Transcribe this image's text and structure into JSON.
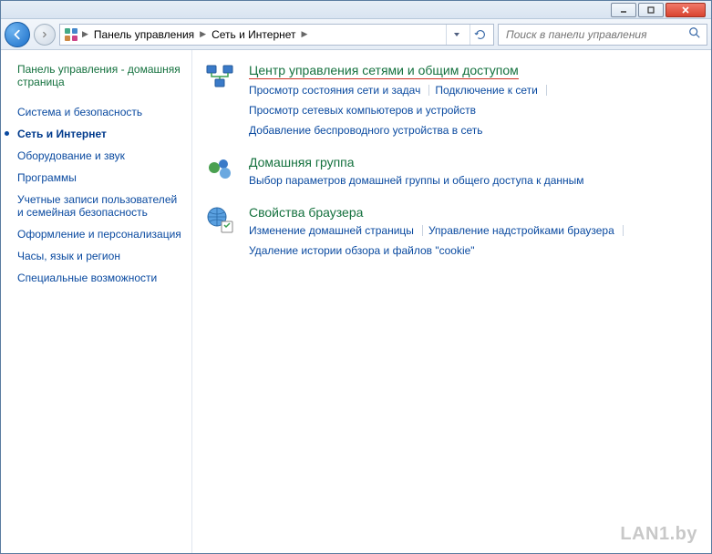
{
  "titlebar": {
    "min": "—",
    "max": "□",
    "close": "✕"
  },
  "breadcrumb": {
    "items": [
      "Панель управления",
      "Сеть и Интернет"
    ]
  },
  "search": {
    "placeholder": "Поиск в панели управления"
  },
  "sidebar": {
    "home": "Панель управления - домашняя страница",
    "items": [
      {
        "label": "Система и безопасность",
        "active": false
      },
      {
        "label": "Сеть и Интернет",
        "active": true
      },
      {
        "label": "Оборудование и звук",
        "active": false
      },
      {
        "label": "Программы",
        "active": false
      },
      {
        "label": "Учетные записи пользователей и семейная безопасность",
        "active": false
      },
      {
        "label": "Оформление и персонализация",
        "active": false
      },
      {
        "label": "Часы, язык и регион",
        "active": false
      },
      {
        "label": "Специальные возможности",
        "active": false
      }
    ]
  },
  "sections": [
    {
      "icon": "network-center",
      "title": "Центр управления сетями и общим доступом",
      "highlighted": true,
      "links": [
        {
          "text": "Просмотр состояния сети и задач",
          "divider": true
        },
        {
          "text": "Подключение к сети",
          "divider": true
        },
        {
          "text": "Просмотр сетевых компьютеров и устройств",
          "divider": false,
          "break": true
        },
        {
          "text": "Добавление беспроводного устройства в сеть",
          "divider": false
        }
      ]
    },
    {
      "icon": "homegroup",
      "title": "Домашняя группа",
      "links": [
        {
          "text": "Выбор параметров домашней группы и общего доступа к данным",
          "divider": false
        }
      ]
    },
    {
      "icon": "internet-options",
      "title": "Свойства браузера",
      "links": [
        {
          "text": "Изменение домашней страницы",
          "divider": true
        },
        {
          "text": "Управление надстройками браузера",
          "divider": true
        },
        {
          "text": "Удаление истории обзора и файлов \"cookie\"",
          "divider": false
        }
      ]
    }
  ],
  "watermark": "LAN1.by"
}
